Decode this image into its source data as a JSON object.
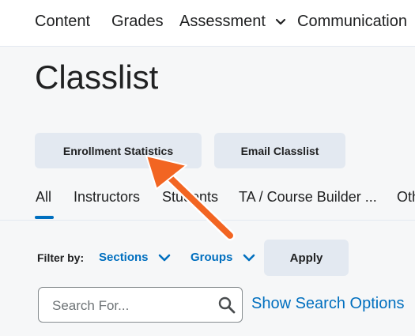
{
  "nav": {
    "items": [
      {
        "label": "Content"
      },
      {
        "label": "Grades"
      },
      {
        "label": "Assessment"
      },
      {
        "label": "Communication"
      }
    ]
  },
  "page": {
    "title": "Classlist"
  },
  "actions": {
    "enrollment_statistics": "Enrollment Statistics",
    "email_classlist": "Email Classlist"
  },
  "tabs": [
    {
      "label": "All",
      "selected": true
    },
    {
      "label": "Instructors"
    },
    {
      "label": "Students"
    },
    {
      "label": "TA / Course Builder ..."
    },
    {
      "label": "Oth"
    }
  ],
  "filter": {
    "label": "Filter by:",
    "sections_label": "Sections",
    "groups_label": "Groups",
    "apply_label": "Apply"
  },
  "search": {
    "placeholder": "Search For...",
    "value": "",
    "options_link": "Show Search Options"
  },
  "colors": {
    "accent": "#006fbf",
    "annotation_arrow": "#f26522",
    "button_bg": "#e3e9f1"
  }
}
